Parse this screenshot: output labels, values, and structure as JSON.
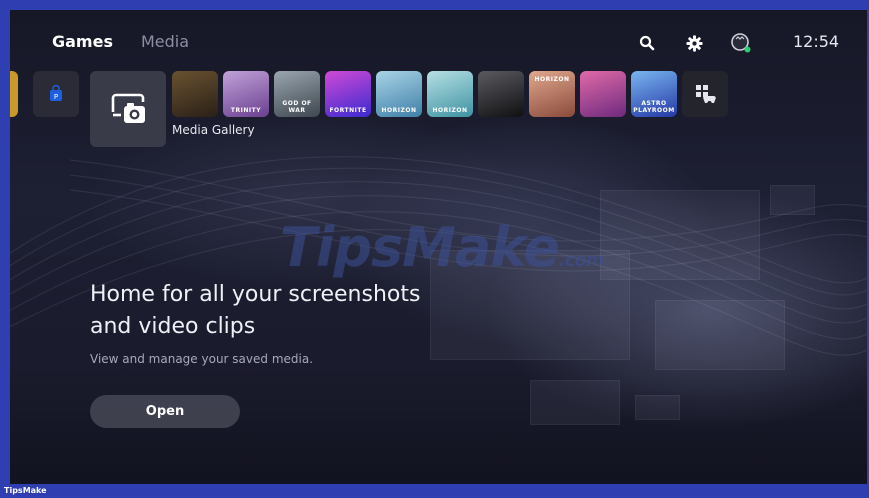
{
  "nav": {
    "tabs": [
      {
        "label": "Games",
        "active": true
      },
      {
        "label": "Media",
        "active": false
      }
    ],
    "icons": [
      "search-icon",
      "settings-gear-icon",
      "profile-avatar-icon"
    ],
    "clock": "12:54"
  },
  "launcher": {
    "selected": {
      "label": "Media Gallery",
      "icon": "camera-screen-icon"
    },
    "tiles": [
      {
        "name": "baldurs-gate",
        "color": "#3a2e1e"
      },
      {
        "name": "trinity-fusion",
        "color": "#7a5aa0",
        "text": "TRINITY"
      },
      {
        "name": "god-of-war",
        "color": "#6e7a86",
        "text": "GOD OF WAR"
      },
      {
        "name": "fortnite",
        "color": "#5a3ad0",
        "text": "FORTNITE"
      },
      {
        "name": "horizon-1",
        "color": "#4e8fb3",
        "text": "HORIZON"
      },
      {
        "name": "horizon-2",
        "color": "#4f9fb0",
        "text": "HORIZON"
      },
      {
        "name": "skyrim",
        "color": "#202022"
      },
      {
        "name": "horizon-bonus",
        "color": "#b27a66",
        "text": "HORIZON"
      },
      {
        "name": "deliver-us",
        "color": "#b64b8e"
      },
      {
        "name": "astro-playroom",
        "color": "#2e4cb6",
        "text": "ASTRO PLAYROOM"
      },
      {
        "name": "game-library",
        "color": "#24252c"
      }
    ]
  },
  "hero": {
    "title_line1": "Home for all your screenshots",
    "title_line2": "and video clips",
    "subtitle": "View and manage your saved media.",
    "button_label": "Open"
  },
  "watermark": {
    "main": "TipsMake",
    "suffix": ".com"
  },
  "footer": {
    "brand": "TipsMake"
  },
  "colors": {
    "frame": "#2f3eb0",
    "background": "#1a1b2c",
    "button": "#464856",
    "online_dot": "#2ecc71"
  }
}
